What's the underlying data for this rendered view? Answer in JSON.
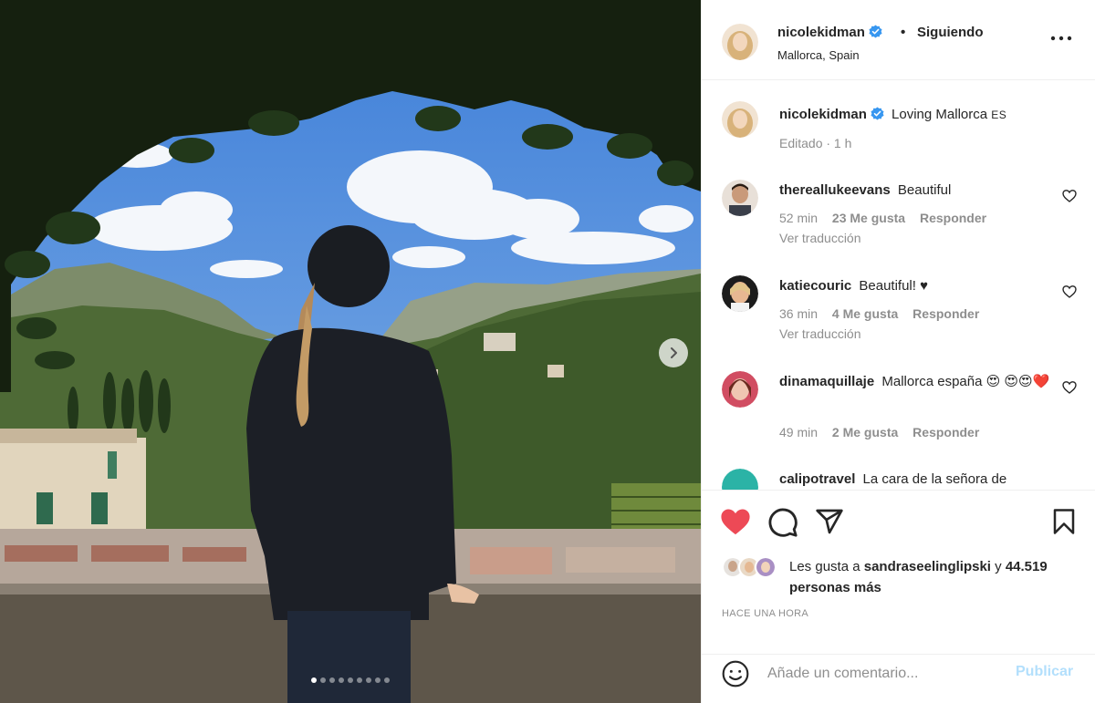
{
  "post": {
    "author": "nicolekidman",
    "follow_label": "Siguiendo",
    "separator": "•",
    "location": "Mallorca, Spain",
    "caption": "Loving Mallorca",
    "caption_flag": "ES",
    "caption_meta": "Editado · 1 h",
    "slide_count": 9,
    "active_slide": 1
  },
  "comments": [
    {
      "user": "thereallukeevans",
      "text": "Beautiful",
      "time": "52 min",
      "likes": "23 Me gusta",
      "reply": "Responder",
      "translate": "Ver traducción"
    },
    {
      "user": "katiecouric",
      "text": "Beautiful! ♥",
      "time": "36 min",
      "likes": "4 Me gusta",
      "reply": "Responder",
      "translate": "Ver traducción"
    },
    {
      "user": "dinamaquillaje",
      "text": "Mallorca españa 😍 😍😍❤️",
      "time": "49 min",
      "likes": "2 Me gusta",
      "reply": "Responder"
    },
    {
      "user": "calipotravel",
      "text": "La cara de la señora de"
    }
  ],
  "likes": {
    "prefix": "Les gusta a",
    "user": "sandraseelinglipski",
    "conj": "y",
    "others": "44.519 personas más"
  },
  "timestamp": "HACE UNA HORA",
  "add_comment": {
    "placeholder": "Añade un comentario...",
    "publish": "Publicar"
  },
  "colors": {
    "like_red": "#ed4956",
    "verified_blue": "#3897f0",
    "publish_disabled": "#b2dffc"
  }
}
